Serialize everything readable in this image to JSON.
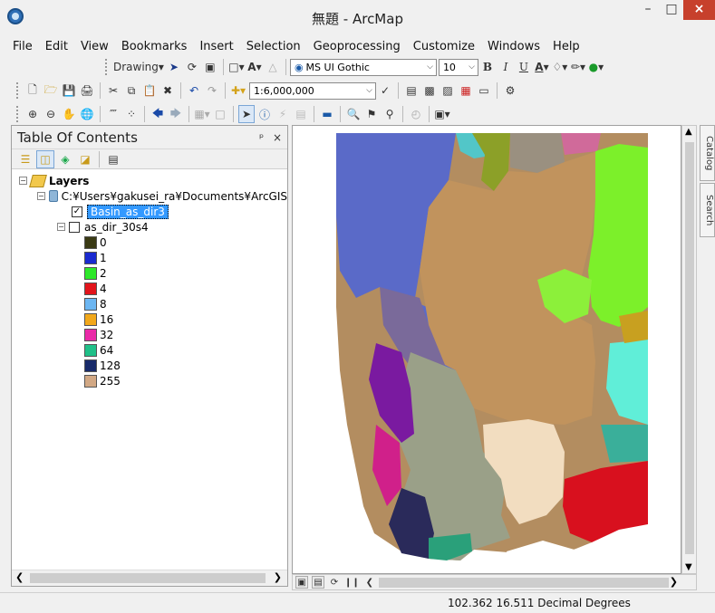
{
  "window": {
    "title": "無題 - ArcMap",
    "minimize": "–",
    "maximize": "□",
    "close": "×"
  },
  "menu": [
    "File",
    "Edit",
    "View",
    "Bookmarks",
    "Insert",
    "Selection",
    "Geoprocessing",
    "Customize",
    "Windows",
    "Help"
  ],
  "toolbar_draw": {
    "drawing_label": "Drawing",
    "font_name": "MS UI Gothic",
    "font_size": "10",
    "bold": "B",
    "italic": "I",
    "underline": "U",
    "text_tool": "A",
    "font_color_label": "A"
  },
  "toolbar_standard": {
    "scale": "1:6,000,000"
  },
  "toc": {
    "title": "Table Of Contents",
    "pin": "ᵖ",
    "close": "×",
    "layers_group": "Layers",
    "data_frame_path": "C:¥Users¥gakusei_ra¥Documents¥ArcGIS",
    "layer_selected": "Basin_as_dir3",
    "layer2": "as_dir_30s4",
    "legend": [
      {
        "label": "0",
        "color": "#3a3a14"
      },
      {
        "label": "1",
        "color": "#1a2ad0"
      },
      {
        "label": "2",
        "color": "#2ee82a"
      },
      {
        "label": "4",
        "color": "#e2141b"
      },
      {
        "label": "8",
        "color": "#6cb6f2"
      },
      {
        "label": "16",
        "color": "#f2a81a"
      },
      {
        "label": "32",
        "color": "#ea2aa8"
      },
      {
        "label": "64",
        "color": "#20c088"
      },
      {
        "label": "128",
        "color": "#182a6a"
      },
      {
        "label": "255",
        "color": "#d2a884"
      }
    ]
  },
  "side_tabs": [
    "Catalog",
    "Search"
  ],
  "status": {
    "coordinates": "102.362  16.511 Decimal Degrees"
  }
}
